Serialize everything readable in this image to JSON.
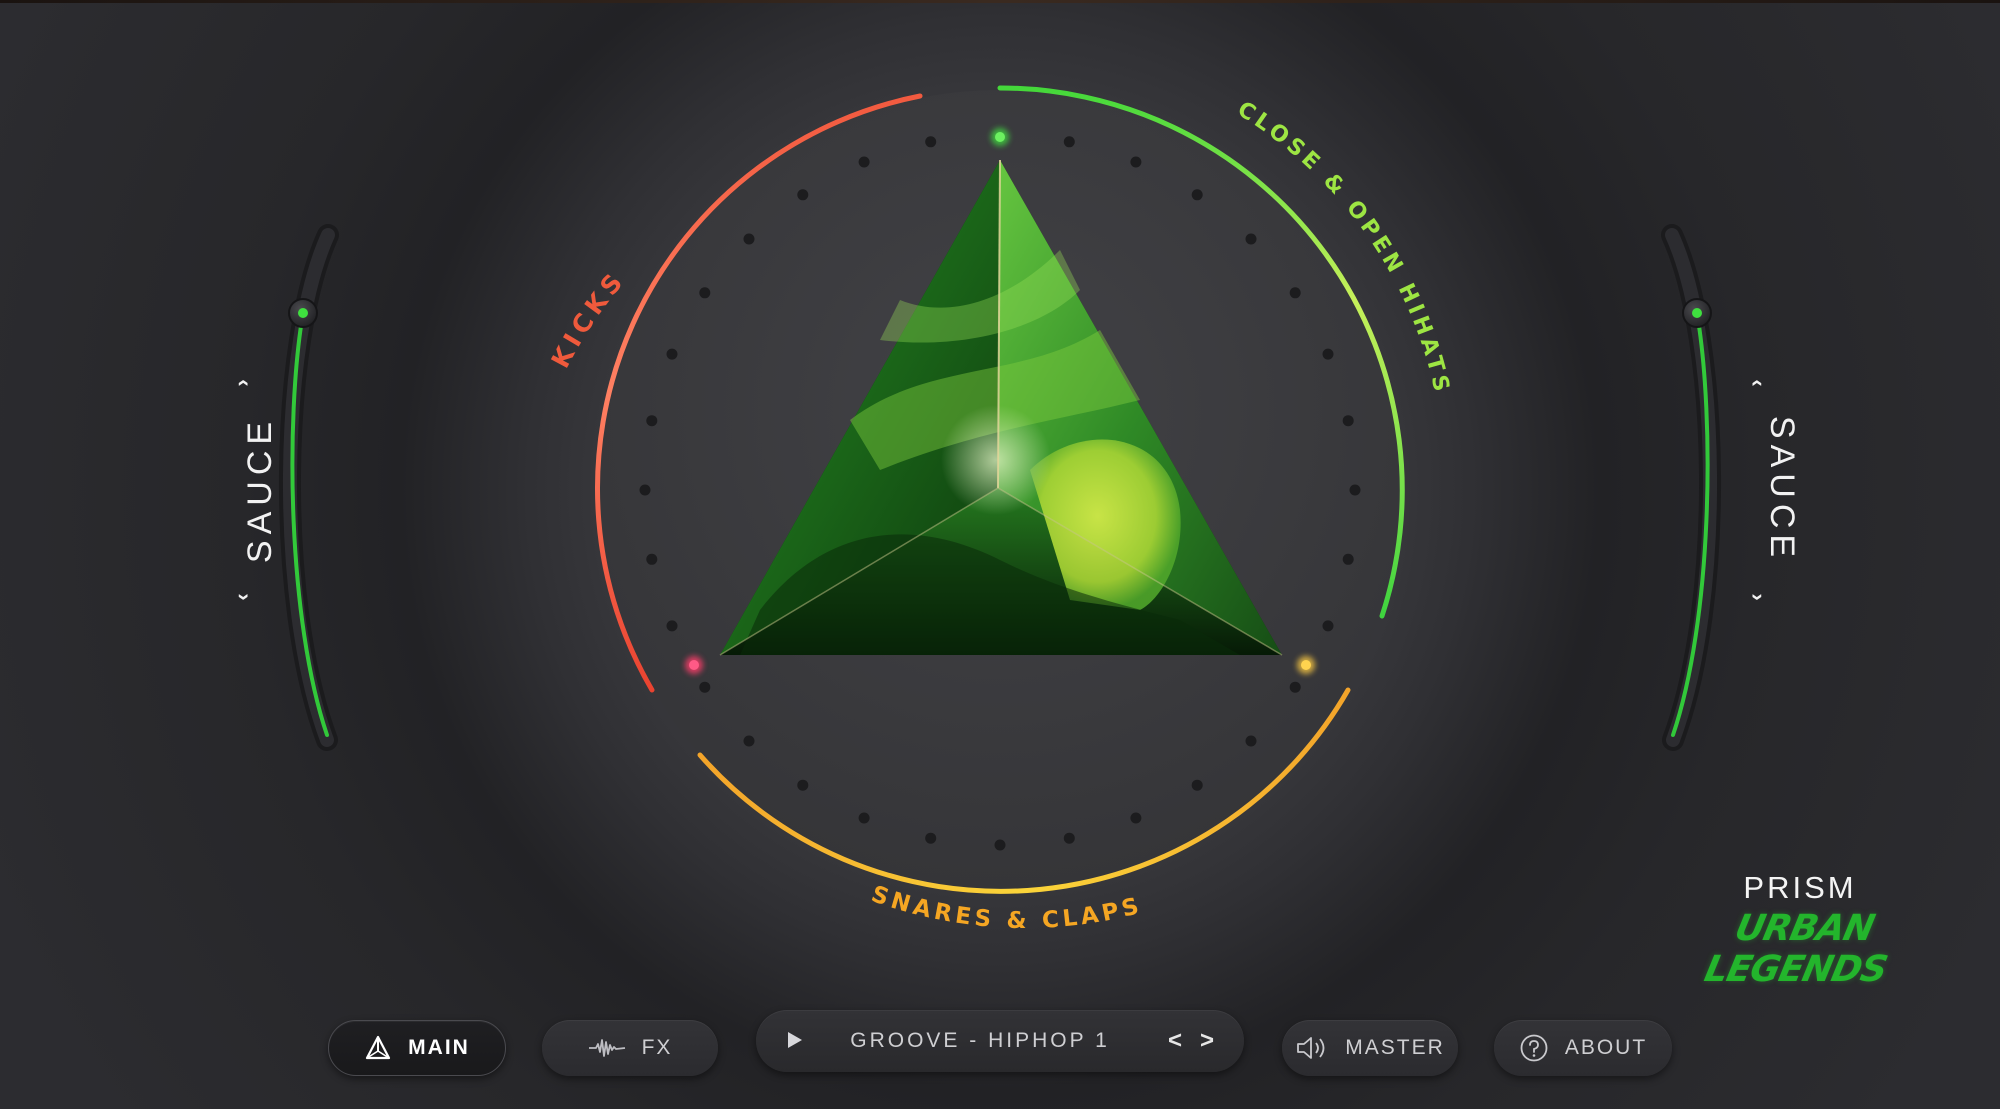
{
  "colors": {
    "kicks": "#ef5a3c",
    "hihats": "#8fe33c",
    "snares": "#f5a623",
    "green_accent": "#3fd43f",
    "brand_green": "#23b52c"
  },
  "prism": {
    "zones": {
      "kicks": "KICKS",
      "hihats": "CLOSE & OPEN HIHATS",
      "snares": "SNARES & CLAPS"
    }
  },
  "sauce_left": {
    "label": "SAUCE",
    "level": 0.85,
    "icons": [
      "chevron-up-icon",
      "chevron-down-icon"
    ]
  },
  "sauce_right": {
    "label": "SAUCE",
    "level": 0.85,
    "icons": [
      "chevron-up-icon",
      "chevron-down-icon"
    ]
  },
  "brand": {
    "title": "PRISM",
    "subtitle": "URBAN LEGENDS"
  },
  "bottom_bar": {
    "main": {
      "label": "MAIN",
      "icon": "prism-icon"
    },
    "fx": {
      "label": "FX",
      "icon": "waveform-icon"
    },
    "groove": {
      "play_icon": "play-icon",
      "name": "GROOVE - HIPHOP 1",
      "prev": "<",
      "next": ">"
    },
    "master": {
      "label": "MASTER",
      "icon": "speaker-icon"
    },
    "about": {
      "label": "ABOUT",
      "icon": "help-icon"
    }
  }
}
